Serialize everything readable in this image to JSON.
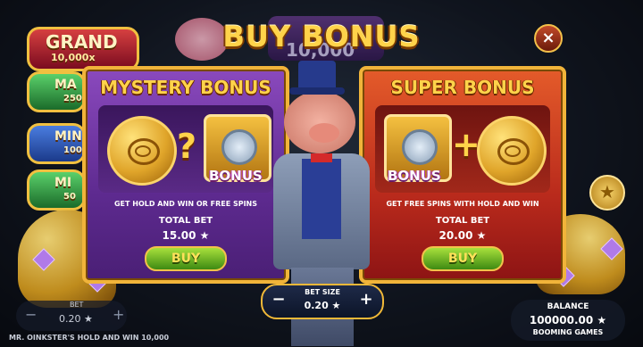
{
  "title": "BUY BONUS",
  "background": {
    "grand_label": "GRAND",
    "grand_value": "10,000x",
    "major_partial": "MA",
    "major_partial_value": "250",
    "minor_partial": "MIN",
    "minor_partial_value": "100",
    "mini_partial": "MI",
    "mini_partial_value": "50",
    "top_value": "10,000"
  },
  "cards": [
    {
      "title": "MYSTERY BONUS",
      "symbol": "?",
      "badge": "BONUS",
      "description": "GET HOLD AND WIN OR FREE SPINS",
      "total_bet_label": "TOTAL BET",
      "total_bet_value": "15.00 ★",
      "buy_label": "BUY"
    },
    {
      "title": "SUPER BONUS",
      "symbol": "+",
      "badge": "BONUS",
      "description": "GET FREE SPINS WITH HOLD AND WIN",
      "total_bet_label": "TOTAL BET",
      "total_bet_value": "20.00 ★",
      "buy_label": "BUY"
    }
  ],
  "bet_size": {
    "label": "BET SIZE",
    "value": "0.20 ★",
    "minus": "−",
    "plus": "+"
  },
  "bet": {
    "label": "BET",
    "value": "0.20 ★",
    "minus": "−",
    "plus": "+"
  },
  "game_name": "MR. OINKSTER'S HOLD AND WIN 10,000",
  "balance": {
    "label": "BALANCE",
    "value": "100000.00 ★",
    "brand": "BOOMING GAMES"
  },
  "close_icon": "×",
  "star_icon": "★",
  "colors": {
    "gold": "#ffd34a",
    "mystery": "#7a3aae",
    "super": "#c8321c",
    "buy_green": "#6fc02a"
  }
}
